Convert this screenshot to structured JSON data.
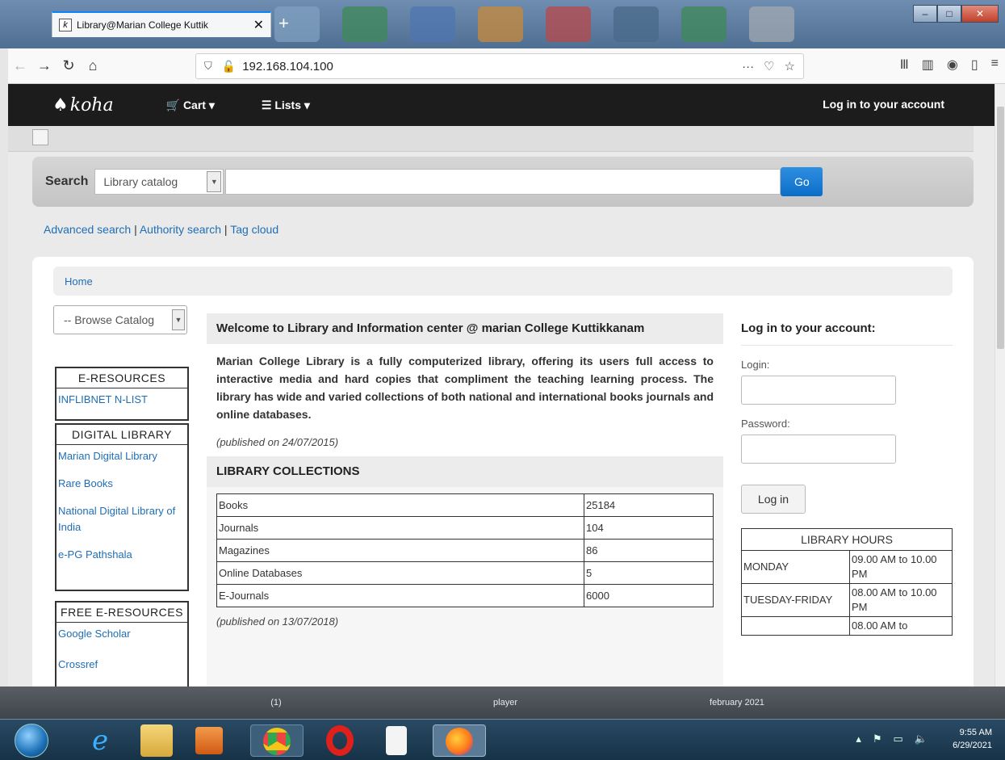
{
  "browser": {
    "tab_title": "Library@Marian College Kuttik",
    "tab_close": "✕",
    "new_tab": "+",
    "url": "192.168.104.100",
    "url_actions": "···",
    "win_min": "‒",
    "win_max": "□",
    "win_close": "✕"
  },
  "koha": {
    "logo": "koha",
    "cart_label": "Cart",
    "lists_label": "Lists",
    "login_link": "Log in to your account"
  },
  "search": {
    "label": "Search",
    "scope": "Library catalog",
    "go": "Go",
    "links": [
      "Advanced search",
      "Authority search",
      "Tag cloud"
    ],
    "sep": "|"
  },
  "breadcrumb": "Home",
  "browse_select": "-- Browse Catalog",
  "sidebar": {
    "eresources": {
      "title": "E-RESOURCES",
      "items": [
        "INFLIBNET N-LIST"
      ]
    },
    "digital": {
      "title": "DIGITAL LIBRARY",
      "items": [
        "Marian Digital Library",
        "Rare Books",
        "National Digital Library of India",
        "e-PG Pathshala"
      ]
    },
    "free": {
      "title": "FREE E-RESOURCES",
      "items": [
        "Google Scholar",
        "Crossref"
      ]
    }
  },
  "news": {
    "welcome_title": "Welcome to Library and Information center @ marian College Kuttikkanam",
    "welcome_body": "Marian College Library is a fully computerized library, offering its users full access to interactive media and hard copies that compliment the teaching learning process. The library has wide and varied collections of both national and international books journals and online databases.",
    "welcome_date": "(published on 24/07/2015)",
    "collections_title": "LIBRARY COLLECTIONS",
    "collections": [
      {
        "name": "Books",
        "count": "25184"
      },
      {
        "name": "Journals",
        "count": "104"
      },
      {
        "name": "Magazines",
        "count": "86"
      },
      {
        "name": "Online Databases",
        "count": "5"
      },
      {
        "name": "E-Journals",
        "count": "6000"
      }
    ],
    "collections_date": "(published on 13/07/2018)"
  },
  "login": {
    "title": "Log in to your account:",
    "login_label": "Login:",
    "password_label": "Password:",
    "button": "Log in"
  },
  "hours": {
    "title": "LIBRARY HOURS",
    "rows": [
      {
        "day": "MONDAY",
        "time": "09.00 AM to 10.00 PM"
      },
      {
        "day": "TUESDAY-FRIDAY",
        "time": "08.00 AM to 10.00 PM"
      },
      {
        "day": "",
        "time": "08.00 AM to"
      }
    ]
  },
  "desktop": {
    "labels": [
      "(1)",
      "player",
      "february 2021"
    ]
  },
  "tray": {
    "time": "9:55 AM",
    "date": "6/29/2021"
  }
}
